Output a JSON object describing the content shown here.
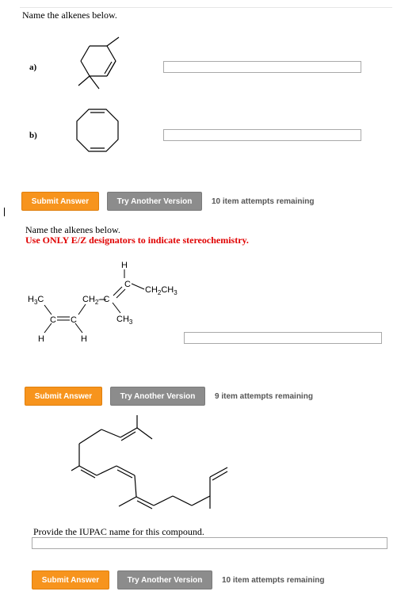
{
  "problem1": {
    "prompt": "Name the alkenes below.",
    "label_a": "a)",
    "label_b": "b)",
    "answer_a": "",
    "answer_b": "",
    "submit_label": "Submit Answer",
    "try_label": "Try Another Version",
    "attempts": "10 item attempts remaining"
  },
  "problem2": {
    "prompt": "Name the alkenes below.",
    "instruction": "Use ONLY E/Z designators to indicate stereochemistry.",
    "structure_labels": {
      "h_top": "H",
      "c_top": "C",
      "ch2ch3": "CH2CH3",
      "ch2": "CH2",
      "c_mid": "C",
      "ch3_bottom": "CH3",
      "h3c": "H3C",
      "c_left": "C",
      "c_right": "C",
      "h_left": "H",
      "h_right": "H"
    },
    "answer": "",
    "submit_label": "Submit Answer",
    "try_label": "Try Another Version",
    "attempts": "9 item attempts remaining"
  },
  "problem3": {
    "prompt": "Provide the IUPAC name for this compound.",
    "answer": "",
    "submit_label": "Submit Answer",
    "try_label": "Try Another Version",
    "attempts": "10 item attempts remaining"
  }
}
